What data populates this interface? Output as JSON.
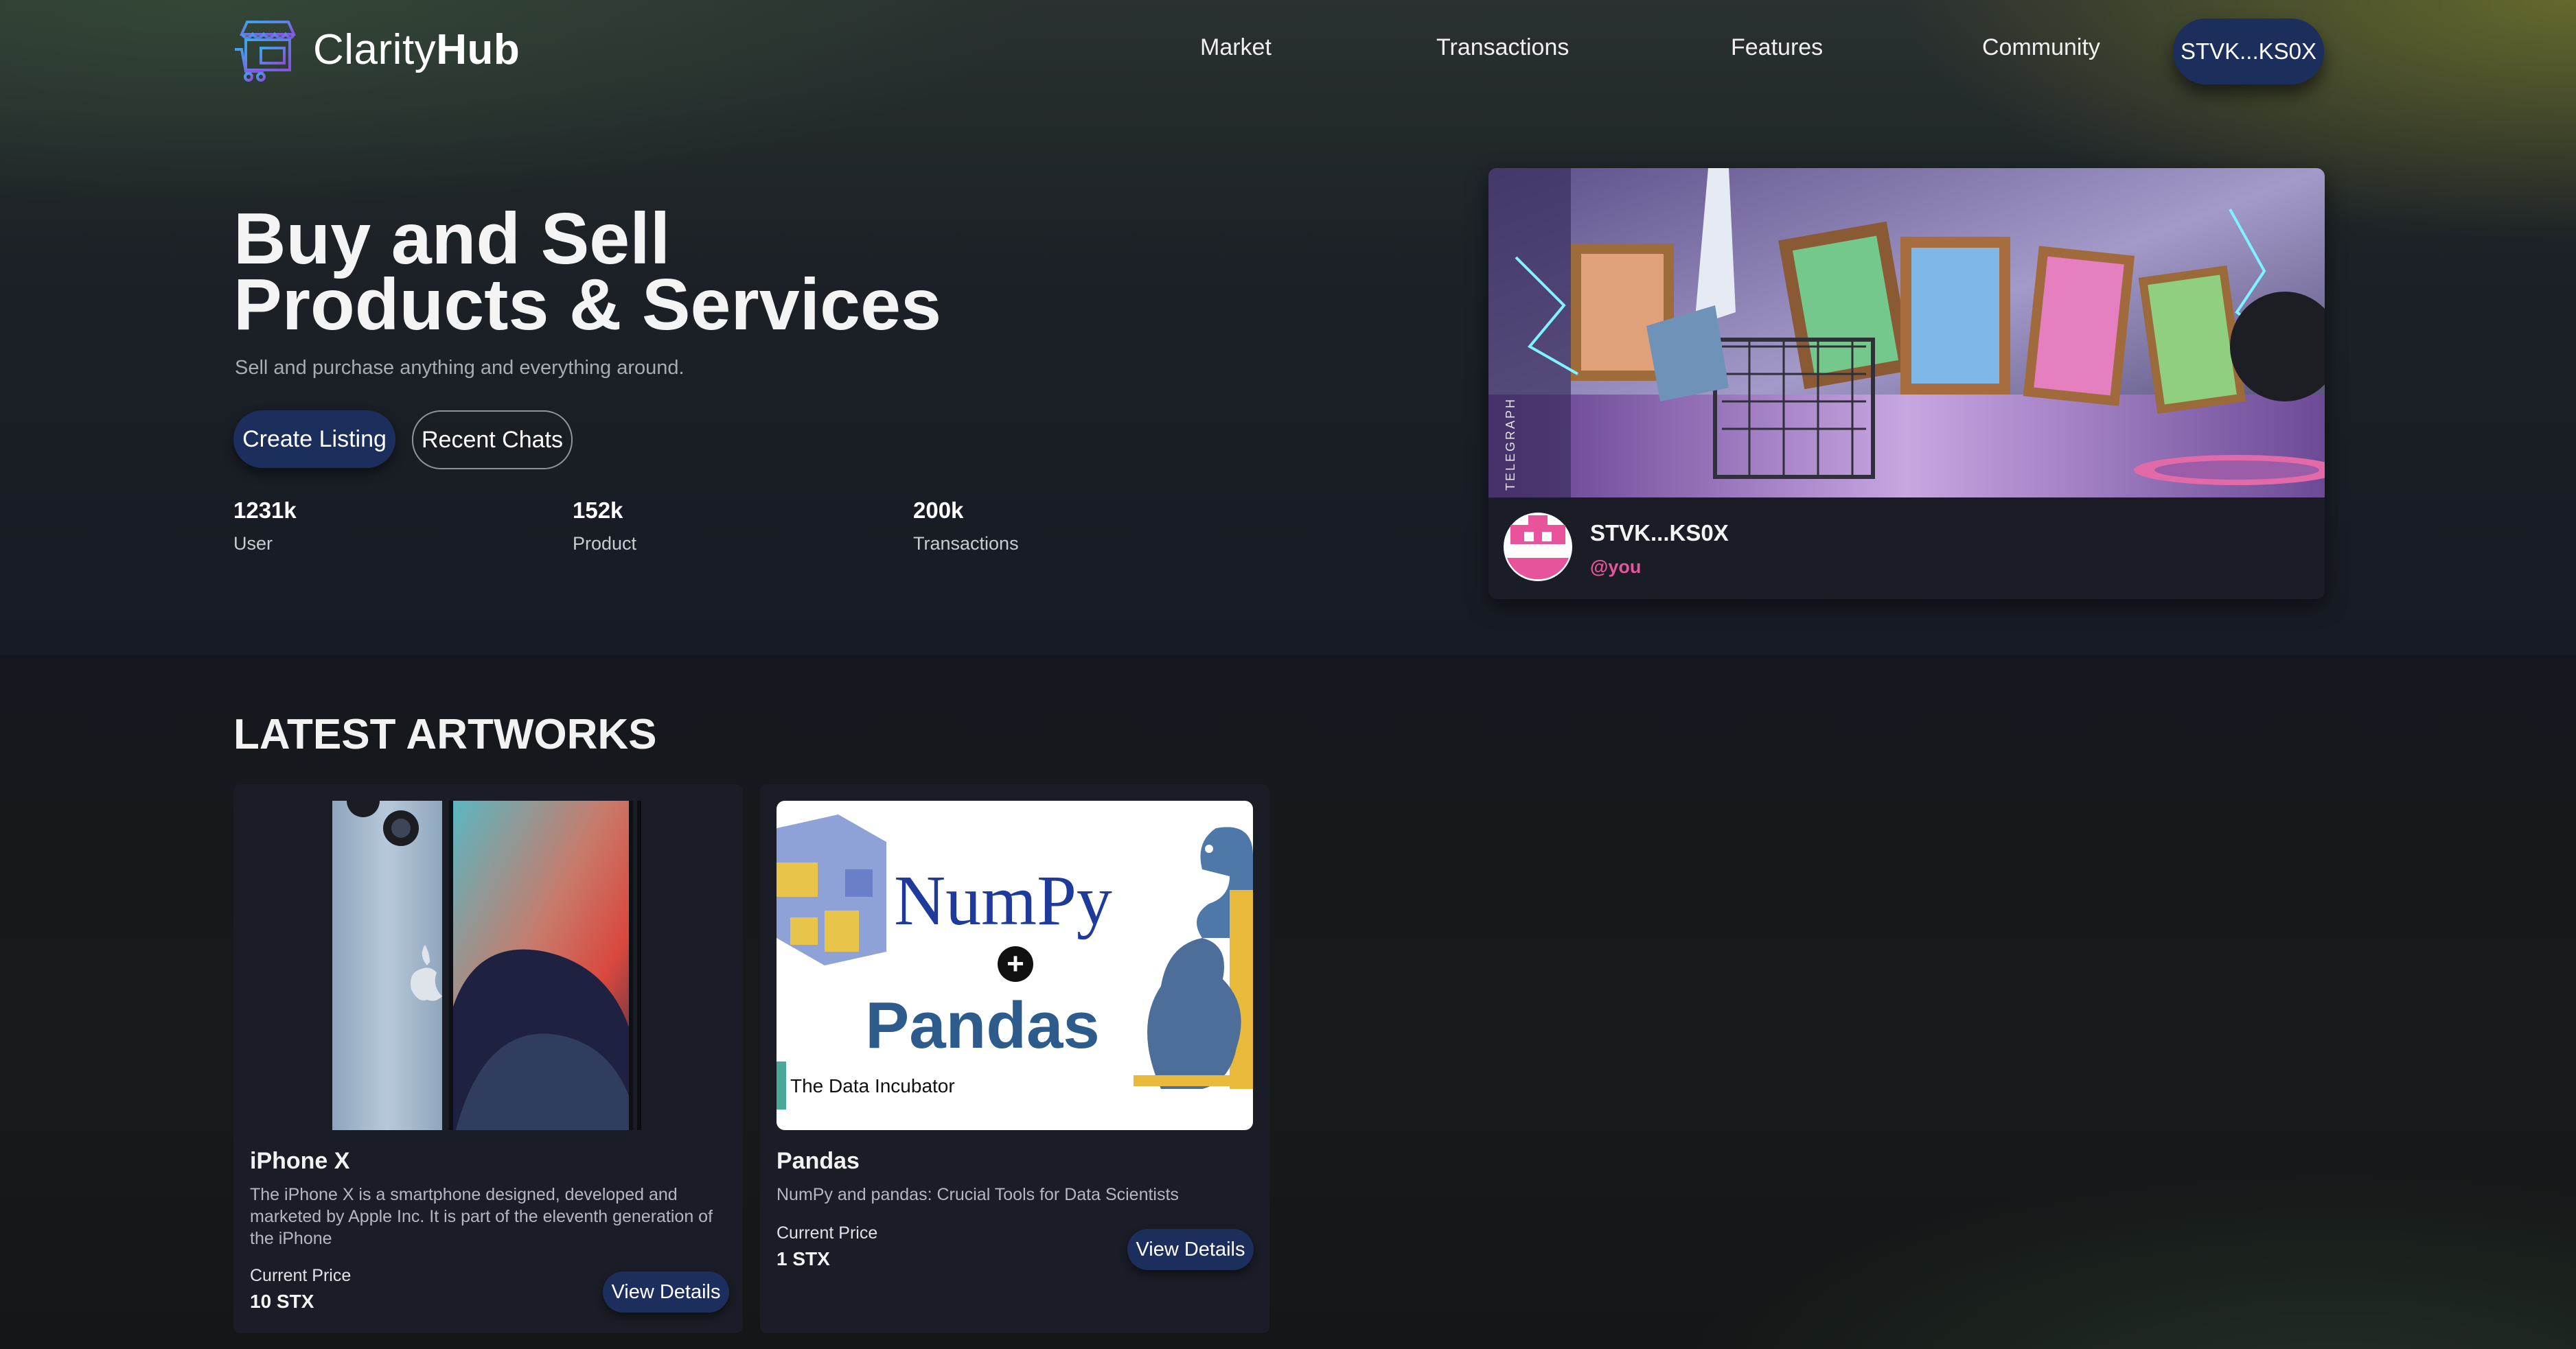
{
  "brand": {
    "name_light": "Clarity",
    "name_bold": "Hub",
    "logo_icon": "shop-cart-icon"
  },
  "nav": {
    "links": [
      "Market",
      "Transactions",
      "Features",
      "Community"
    ],
    "wallet_label": "STVK...KS0X"
  },
  "hero": {
    "title_line1": "Buy and Sell",
    "title_line2": "Products & Services",
    "subtitle": "Sell and purchase anything and everything around.",
    "primary_button": "Create Listing",
    "secondary_button": "Recent Chats",
    "stats": [
      {
        "value": "1231k",
        "label": "User"
      },
      {
        "value": "152k",
        "label": "Product"
      },
      {
        "value": "200k",
        "label": "Transactions"
      }
    ]
  },
  "profile": {
    "banner_tag": "TELEGRAPH",
    "name": "STVK...KS0X",
    "handle": "@you"
  },
  "latest": {
    "title": "LATEST ARTWORKS",
    "items": [
      {
        "title": "iPhone X",
        "description": "The iPhone X is a smartphone designed, developed and marketed by Apple Inc. It is part of the eleventh generation of the iPhone",
        "price_label": "Current Price",
        "price": "10 STX",
        "button": "View Details"
      },
      {
        "title": "Pandas",
        "description": "NumPy and pandas: Crucial Tools for Data Scientists",
        "price_label": "Current Price",
        "price": "1 STX",
        "button": "View Details",
        "image_text": {
          "numpy": "NumPy",
          "plus": "+",
          "pandas": "Pandas",
          "credit": "The Data Incubator"
        }
      }
    ]
  },
  "colors": {
    "accent_button": "#1b2e5c",
    "handle_pink": "#e7549b",
    "card_bg": "#1a1d26"
  }
}
